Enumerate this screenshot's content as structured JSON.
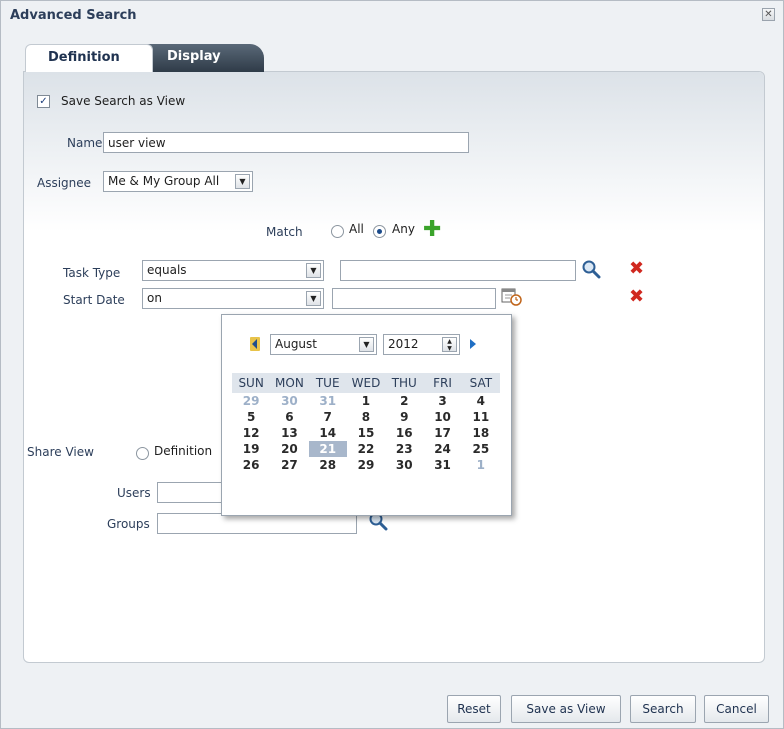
{
  "dialog": {
    "title": "Advanced Search",
    "close_glyph": "✕"
  },
  "tabs": [
    {
      "label": "Definition",
      "selected": true
    },
    {
      "label": "Display",
      "selected": false
    }
  ],
  "form": {
    "save_as_view_label": "Save Search as View",
    "save_as_view_checked": true,
    "name_label": "Name",
    "name_value": "user view",
    "assignee_label": "Assignee",
    "assignee_value": "Me & My Group All",
    "match_label": "Match",
    "match_all_label": "All",
    "match_any_label": "Any",
    "match_selected": "Any",
    "conditions": [
      {
        "field": "Task Type",
        "operator": "equals",
        "value": ""
      },
      {
        "field": "Start Date",
        "operator": "on",
        "value": ""
      }
    ],
    "share_view_label": "Share View",
    "share_definition_label": "Definition",
    "users_label": "Users",
    "users_value": "",
    "groups_label": "Groups",
    "groups_value": ""
  },
  "calendar": {
    "month": "August",
    "year": "2012",
    "weekdays": [
      "SUN",
      "MON",
      "TUE",
      "WED",
      "THU",
      "FRI",
      "SAT"
    ],
    "weeks": [
      [
        "29",
        "30",
        "31",
        "1",
        "2",
        "3",
        "4"
      ],
      [
        "5",
        "6",
        "7",
        "8",
        "9",
        "10",
        "11"
      ],
      [
        "12",
        "13",
        "14",
        "15",
        "16",
        "17",
        "18"
      ],
      [
        "19",
        "20",
        "21",
        "22",
        "23",
        "24",
        "25"
      ],
      [
        "26",
        "27",
        "28",
        "29",
        "30",
        "31",
        "1"
      ]
    ],
    "selected_day": "21"
  },
  "footer": {
    "reset_label": "Reset",
    "save_view_label": "Save as View",
    "search_label": "Search",
    "cancel_label": "Cancel"
  },
  "icons": {
    "accent_plus": "#3aa32a",
    "accent_remove": "#d0281f"
  }
}
